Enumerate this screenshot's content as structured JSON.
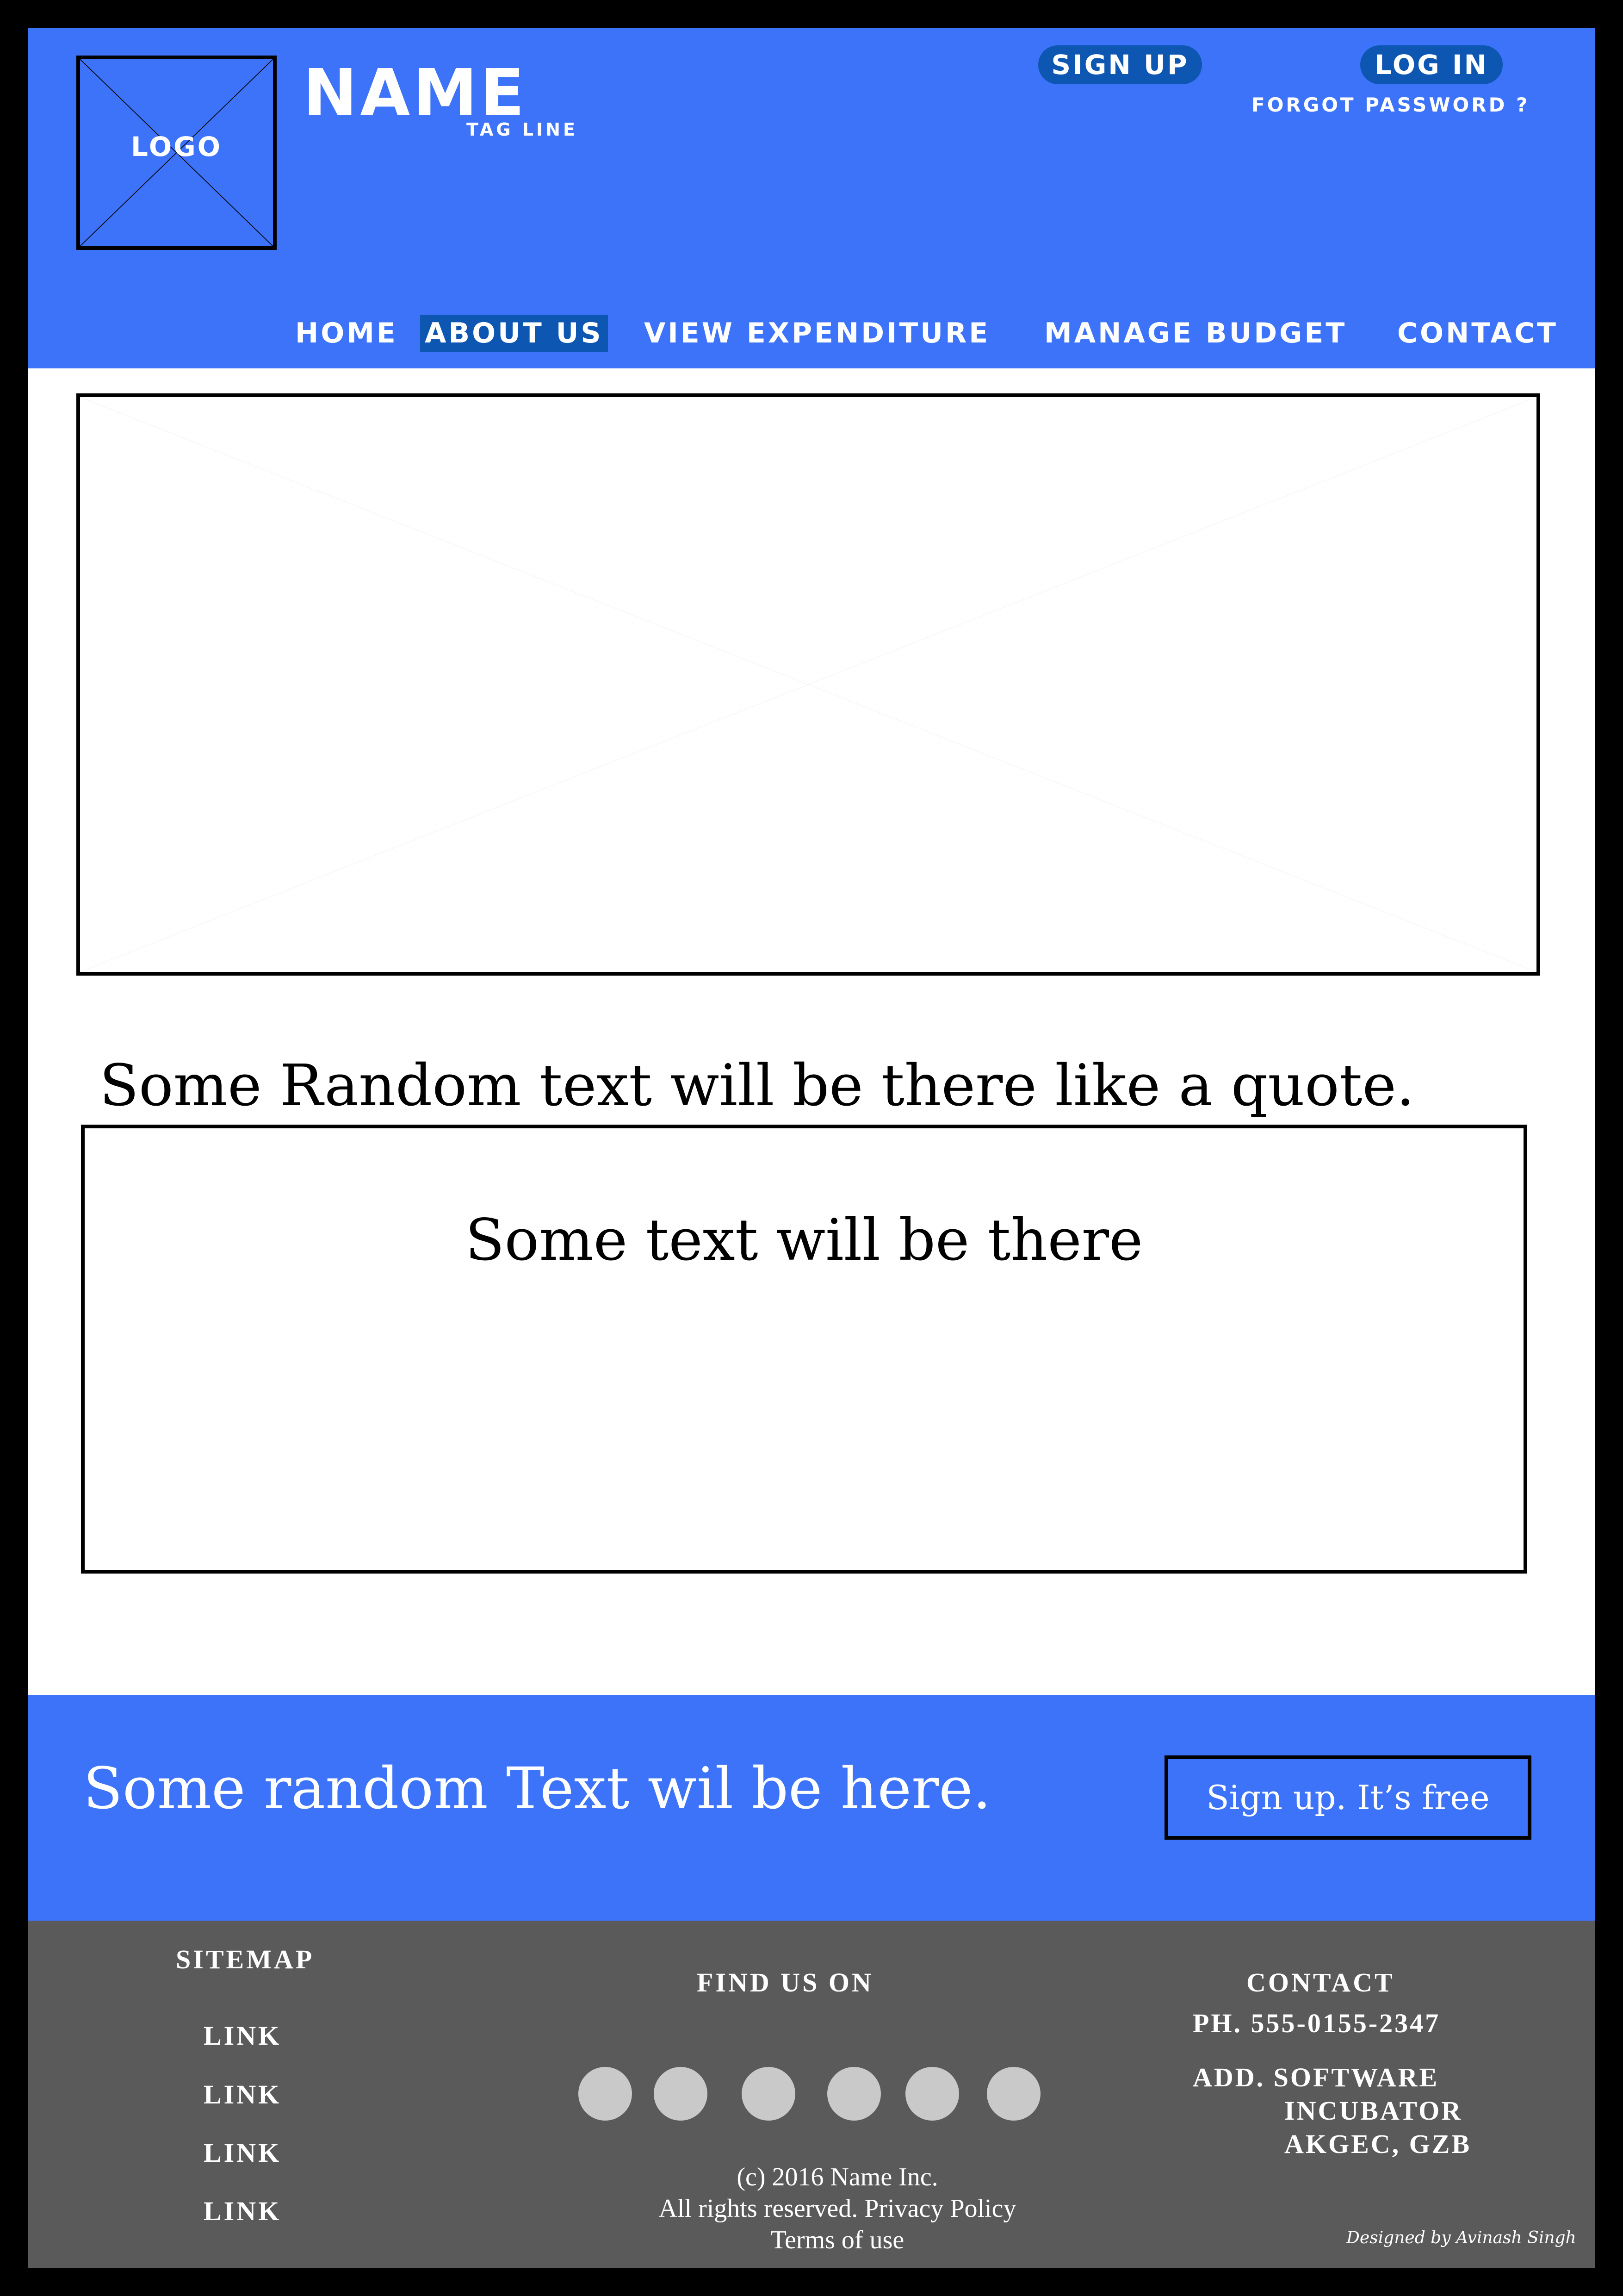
{
  "header": {
    "logo_label": "LOGO",
    "brand_name": "NAME",
    "tag_line": "TAG LINE",
    "signup_label": "SIGN UP",
    "login_label": "LOG IN",
    "forgot_password": "FORGOT PASSWORD ?"
  },
  "nav": {
    "items": [
      {
        "label": "HOME"
      },
      {
        "label": "ABOUT US",
        "active": true
      },
      {
        "label": "VIEW EXPENDITURE"
      },
      {
        "label": "MANAGE BUDGET"
      },
      {
        "label": "CONTACT"
      }
    ]
  },
  "main": {
    "quote": "Some Random text will be there like a quote.",
    "box_text": "Some text will be there"
  },
  "cta": {
    "text": "Some random Text wil be here.",
    "button_label": "Sign up. It’s free"
  },
  "footer": {
    "sitemap_title": "SITEMAP",
    "links": [
      "LINK",
      "LINK",
      "LINK",
      "LINK"
    ],
    "find_us_title": "FIND US ON",
    "social_count_icons": [
      "social-icon",
      "social-icon",
      "social-icon",
      "social-icon",
      "social-icon",
      "social-icon"
    ],
    "copyright": "(c) 2016 Name Inc.",
    "rights": "All rights reserved. Privacy Policy",
    "terms": "Terms of use",
    "contact_title": "CONTACT",
    "phone": "PH. 555-0155-2347",
    "address_line1": "ADD. SOFTWARE",
    "address_line2": "INCUBATOR",
    "address_line3": "AKGEC, GZB",
    "credit": "Designed by Avinash Singh"
  },
  "colors": {
    "accent": "#3d73f8",
    "accent_dark": "#0d56b1",
    "footer_bg": "#5b5a5b",
    "frame": "#000000"
  }
}
